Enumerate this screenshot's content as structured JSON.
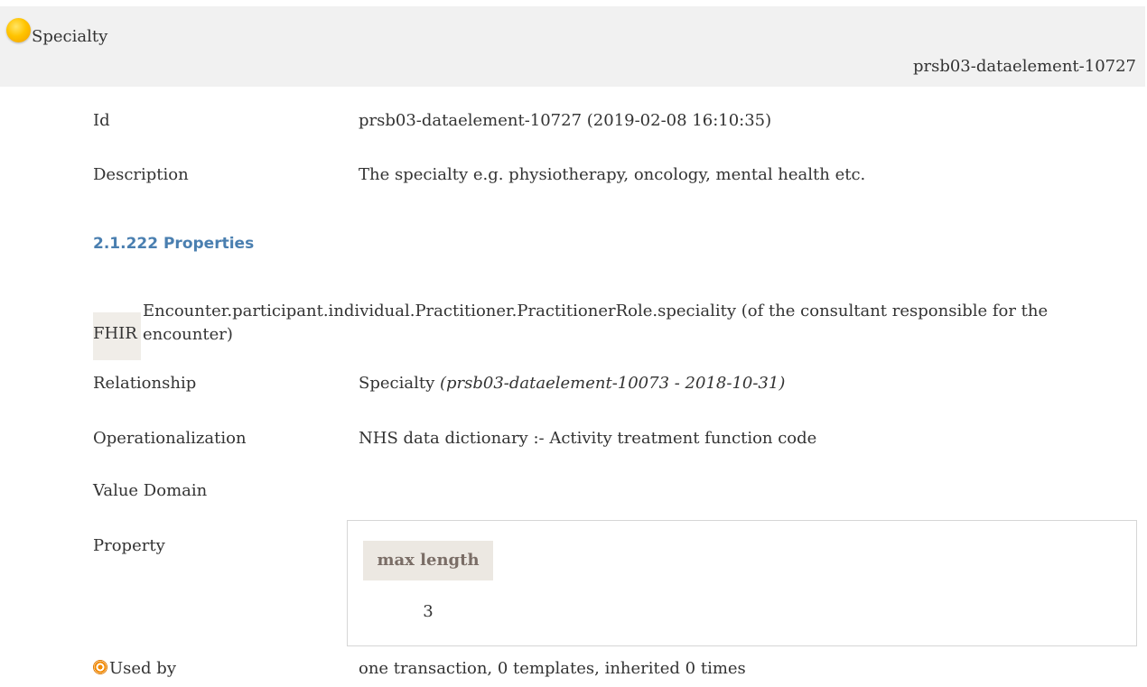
{
  "header": {
    "title": "Specialty",
    "id": "prsb03-dataelement-10727",
    "status_color": "#ffc400"
  },
  "rows": {
    "id": {
      "label": "Id",
      "value": "prsb03-dataelement-10727 (2019-02-08 16:10:35)"
    },
    "description": {
      "label": "Description",
      "value": "The specialty e.g. physiotherapy, oncology, mental health etc."
    }
  },
  "properties": {
    "section_title": "2.1.222 Properties",
    "fhir_label": "FHIR",
    "fhir_text": "Encounter.participant.individual.Practitioner.PractitionerRole.speciality (of the consultant responsible for the encounter)"
  },
  "relationship": {
    "label": "Relationship",
    "value_main": "Specialty",
    "value_ref": "(prsb03-dataelement-10073 - 2018-10-31)"
  },
  "operationalization": {
    "label": "Operationalization",
    "value": "NHS data dictionary :- Activity treatment function code"
  },
  "value_domain": {
    "label": "Value Domain"
  },
  "property": {
    "label": "Property",
    "column_header": "max length",
    "column_value": "3"
  },
  "used_by": {
    "icon": "target-icon",
    "label": "Used by",
    "value": "one transaction, 0 templates, inherited 0 times"
  }
}
